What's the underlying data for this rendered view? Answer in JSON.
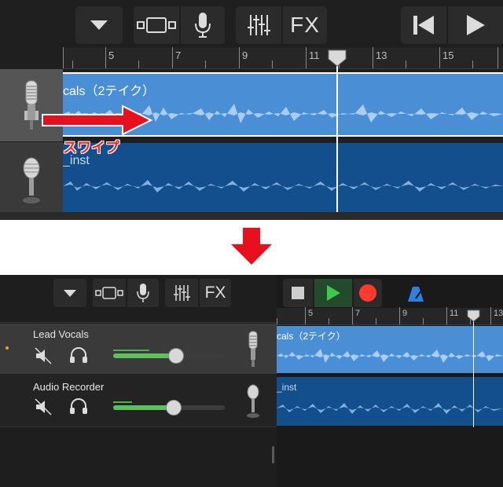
{
  "top": {
    "toolbar": {
      "fx_label": "FX"
    },
    "ruler": {
      "labels": [
        "5",
        "7",
        "9",
        "11",
        "13",
        "15"
      ]
    },
    "tracks": [
      {
        "region_name": "cals（2テイク）",
        "icon": "condenser-mic-icon"
      },
      {
        "region_name": "_inst",
        "icon": "dynamic-mic-icon"
      }
    ],
    "swipe_label": "スワイプ"
  },
  "bottom": {
    "toolbar": {
      "fx_label": "FX"
    },
    "transport_colors": {
      "play": "#3fc94a",
      "record": "#ff3b30",
      "metronome": "#2f7fe0"
    },
    "ruler": {
      "labels": [
        "5",
        "7",
        "9",
        "11",
        "13"
      ]
    },
    "tracks": [
      {
        "name": "Lead Vocals",
        "region_name": "cals（2テイク）",
        "volume": 0.58,
        "icon": "condenser-mic-icon"
      },
      {
        "name": "Audio Recorder",
        "region_name": "_inst",
        "volume": 0.55,
        "icon": "dynamic-mic-icon"
      }
    ]
  },
  "colors": {
    "region_light": "#4a8fd6",
    "region_dark": "#124f8c",
    "swipe_arrow": "#e8101c"
  }
}
